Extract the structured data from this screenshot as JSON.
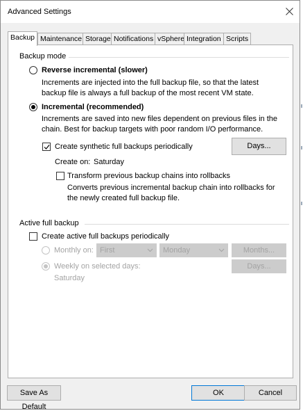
{
  "window": {
    "title": "Advanced Settings"
  },
  "tabs": [
    {
      "label": "Backup",
      "active": true
    },
    {
      "label": "Maintenance"
    },
    {
      "label": "Storage"
    },
    {
      "label": "Notifications"
    },
    {
      "label": "vSphere"
    },
    {
      "label": "Integration"
    },
    {
      "label": "Scripts"
    }
  ],
  "backup_mode": {
    "group_label": "Backup mode",
    "reverse": {
      "label": "Reverse incremental (slower)",
      "description": "Increments are injected into the full backup file, so that the latest backup file is always a full backup of the most recent VM state.",
      "selected": false
    },
    "incremental": {
      "label": "Incremental (recommended)",
      "description": "Increments are saved into new files dependent on previous files in the chain. Best for backup targets with poor random I/O performance.",
      "selected": true
    },
    "synthetic": {
      "label": "Create synthetic full backups periodically",
      "checked": true,
      "days_button": "Days...",
      "create_on_label": "Create on:",
      "create_on_value": "Saturday"
    },
    "transform": {
      "label": "Transform previous backup chains into rollbacks",
      "checked": false,
      "description": "Converts previous incremental backup chain into rollbacks for the newly created full backup file."
    }
  },
  "active_full": {
    "group_label": "Active full backup",
    "create": {
      "label": "Create active full backups periodically",
      "checked": false
    },
    "monthly": {
      "label": "Monthly on:",
      "week_value": "First",
      "day_value": "Monday",
      "months_button": "Months..."
    },
    "weekly": {
      "label": "Weekly on selected days:",
      "days_button": "Days...",
      "days_value": "Saturday"
    }
  },
  "footer": {
    "save_default": "Save As Default",
    "ok": "OK",
    "cancel": "Cancel"
  },
  "colors": {
    "dialog_bg": "#f0f0f0",
    "panel_bg": "#ffffff",
    "disabled_text": "#a3a3a3",
    "accent_border": "#0078d7"
  }
}
